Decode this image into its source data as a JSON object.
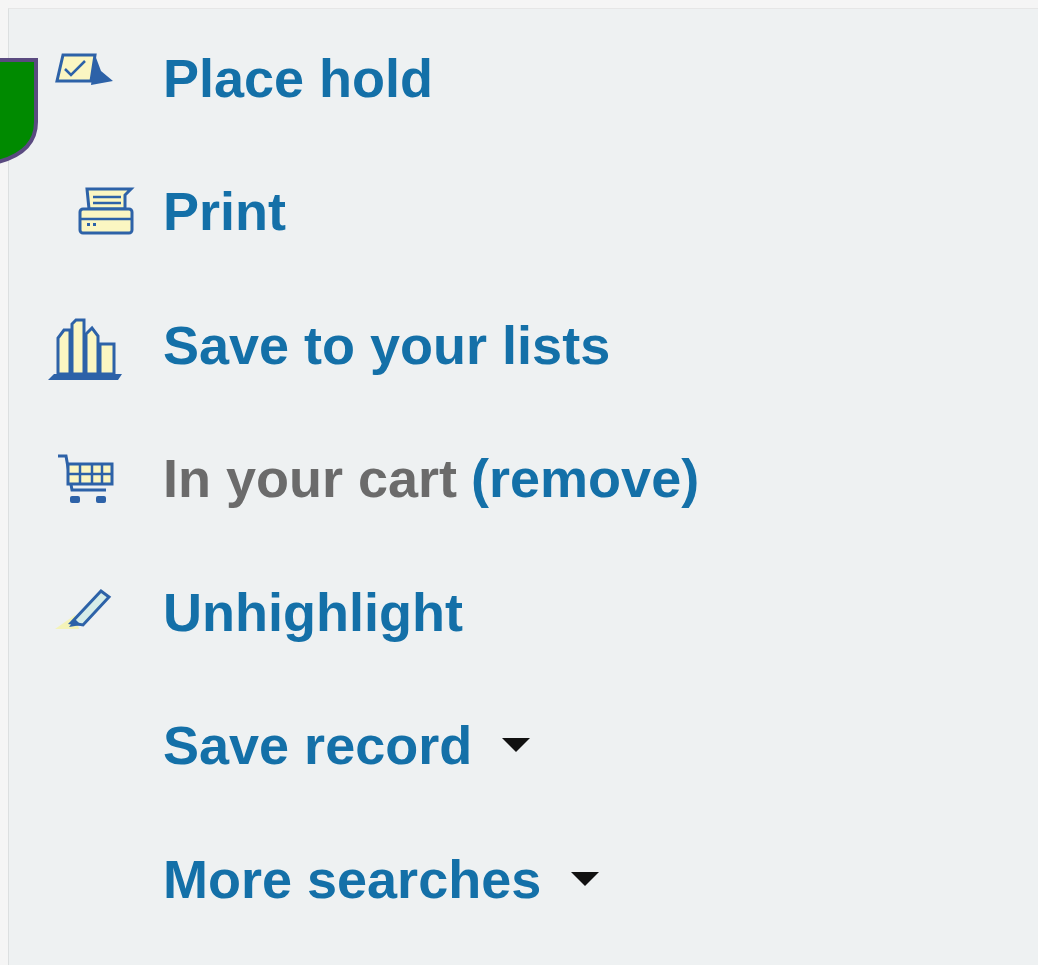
{
  "actions": [
    {
      "kind": "hold",
      "label": "Place hold"
    },
    {
      "kind": "print",
      "label": "Print"
    },
    {
      "kind": "lists",
      "label": "Save to your lists"
    },
    {
      "kind": "cart",
      "label": "In your cart",
      "link": "(remove)"
    },
    {
      "kind": "highlight",
      "label": "Unhighlight"
    },
    {
      "kind": "dropdown",
      "label": "Save record"
    },
    {
      "kind": "dropdown",
      "label": "More searches"
    }
  ]
}
